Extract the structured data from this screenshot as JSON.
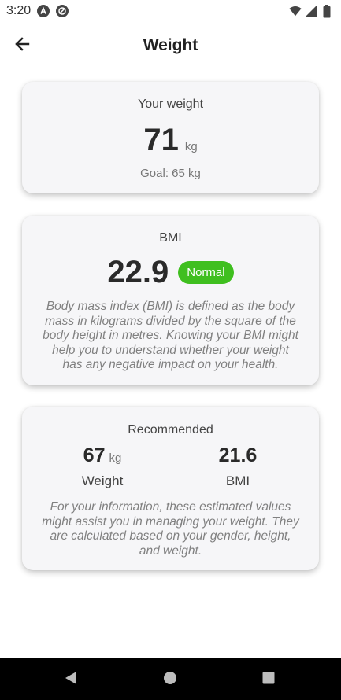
{
  "status_bar": {
    "time": "3:20"
  },
  "header": {
    "title": "Weight",
    "back_icon": "arrow-left-icon"
  },
  "weight_card": {
    "label": "Your weight",
    "value": "71",
    "unit": "kg",
    "goal": "Goal: 65 kg"
  },
  "bmi_card": {
    "label": "BMI",
    "value": "22.9",
    "status": "Normal",
    "status_color": "#3fbf1f",
    "description": "Body mass index (BMI) is defined as the body mass in kilograms divided by the square of the body height in metres. Knowing your BMI might help you to understand whether your weight has any negative impact on your health."
  },
  "recommended_card": {
    "label": "Recommended",
    "weight": {
      "value": "67",
      "unit": "kg",
      "label": "Weight"
    },
    "bmi": {
      "value": "21.6",
      "label": "BMI"
    },
    "description": "For your information, these estimated values might assist you in managing your weight. They are calculated based on your gender, height, and weight."
  },
  "nav_bar": {
    "back_icon": "triangle-back-icon",
    "home_icon": "circle-home-icon",
    "recent_icon": "square-recents-icon"
  }
}
